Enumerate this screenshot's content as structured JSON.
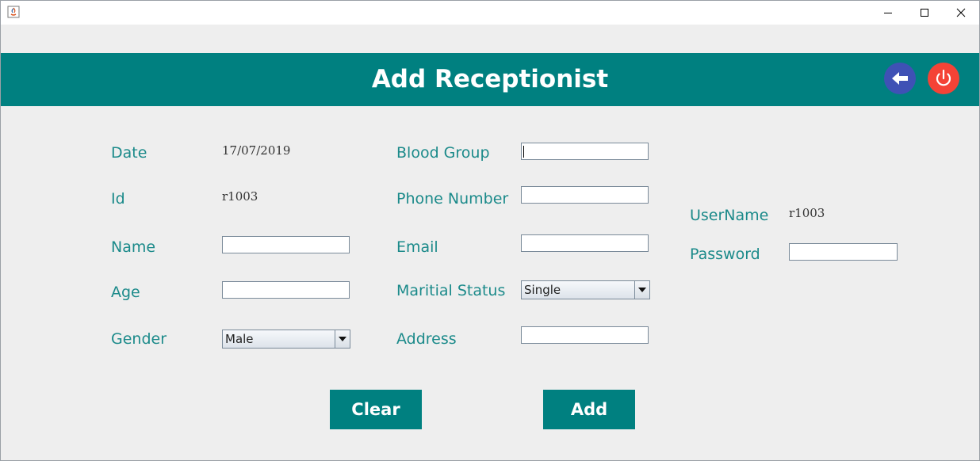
{
  "window": {
    "title": ""
  },
  "header": {
    "title": "Add Receptionist"
  },
  "form": {
    "date": {
      "label": "Date",
      "value": "17/07/2019"
    },
    "id": {
      "label": "Id",
      "value": "r1003"
    },
    "name": {
      "label": "Name",
      "value": ""
    },
    "age": {
      "label": "Age",
      "value": ""
    },
    "gender": {
      "label": "Gender",
      "selected": "Male"
    },
    "blood_group": {
      "label": "Blood Group",
      "value": ""
    },
    "phone": {
      "label": "Phone Number",
      "value": ""
    },
    "email": {
      "label": "Email",
      "value": ""
    },
    "marital_status": {
      "label": "Maritial Status",
      "selected": "Single"
    },
    "address": {
      "label": "Address",
      "value": ""
    },
    "username": {
      "label": "UserName",
      "value": "r1003"
    },
    "password": {
      "label": "Password",
      "value": ""
    }
  },
  "buttons": {
    "clear": "Clear",
    "add": "Add"
  },
  "icons": {
    "back": "arrow-left-icon",
    "power": "power-icon",
    "app": "java-app-icon"
  },
  "colors": {
    "header_bg": "#008080",
    "label": "#1b8a8a",
    "back_button": "#3f51b5",
    "power_button": "#f44336",
    "background": "#eeeeee"
  }
}
